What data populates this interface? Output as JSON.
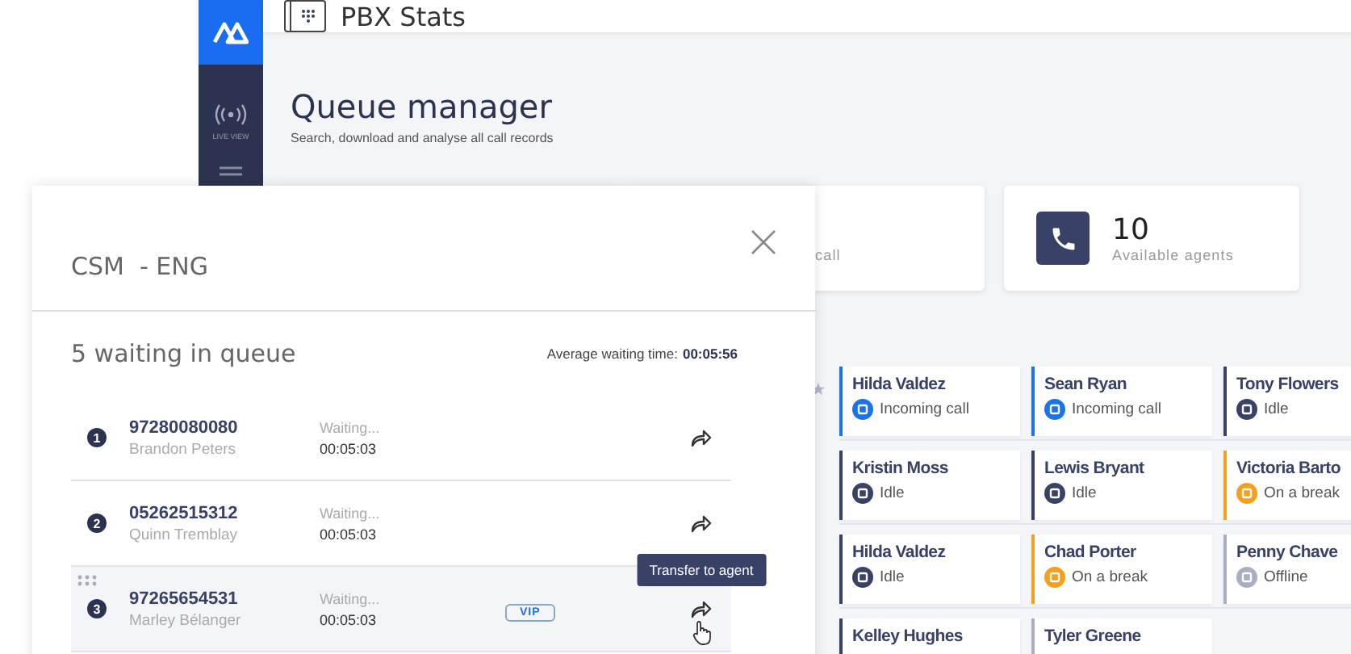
{
  "app": {
    "title": "PBX Stats",
    "sidebar": [
      {
        "label": "LIVE VIEW"
      }
    ]
  },
  "page": {
    "title": "Queue manager",
    "subtitle": "Search, download and analyse all call records"
  },
  "stats": [
    {
      "label": "call"
    },
    {
      "value": "10",
      "label": "Available agents"
    }
  ],
  "agents": [
    [
      {
        "name": "Hilda Valdez",
        "kind": "incoming",
        "status_label": "Incoming call"
      },
      {
        "name": "Sean Ryan",
        "kind": "incoming",
        "status_label": "Incoming call"
      },
      {
        "name": "Tony Flowers",
        "kind": "idle",
        "status_label": "Idle"
      }
    ],
    [
      {
        "name": "Kristin Moss",
        "kind": "idle",
        "status_label": "Idle"
      },
      {
        "name": "Lewis Bryant",
        "kind": "idle",
        "status_label": "Idle"
      },
      {
        "name": "Victoria Barto",
        "kind": "break",
        "status_label": "On a break"
      }
    ],
    [
      {
        "name": "Hilda Valdez",
        "kind": "idle",
        "status_label": "Idle"
      },
      {
        "name": "Chad Porter",
        "kind": "break",
        "status_label": "On a break"
      },
      {
        "name": "Penny Chave",
        "kind": "offline",
        "status_label": "Offline"
      }
    ],
    [
      {
        "name": "Kelley Hughes",
        "kind": "idle"
      },
      {
        "name": "Tyler Greene",
        "kind": "offline"
      }
    ]
  ],
  "panel": {
    "title": "CSM  - ENG",
    "queue_title": "5 waiting in queue",
    "avg_label": "Average waiting time:",
    "avg_value": "00:05:56",
    "calls": [
      {
        "index": "1",
        "phone": "97280080080",
        "caller": "Brandon Peters",
        "status": "Waiting...",
        "time": "00:05:03",
        "vip": false,
        "hovered": false
      },
      {
        "index": "2",
        "phone": "05262515312",
        "caller": "Quinn Tremblay",
        "status": "Waiting...",
        "time": "00:05:03",
        "vip": false,
        "hovered": false
      },
      {
        "index": "3",
        "phone": "97265654531",
        "caller": "Marley Bélanger",
        "status": "Waiting...",
        "time": "00:05:03",
        "vip": true,
        "vip_label": "VIP",
        "hovered": true,
        "tooltip": "Transfer to agent"
      }
    ]
  }
}
